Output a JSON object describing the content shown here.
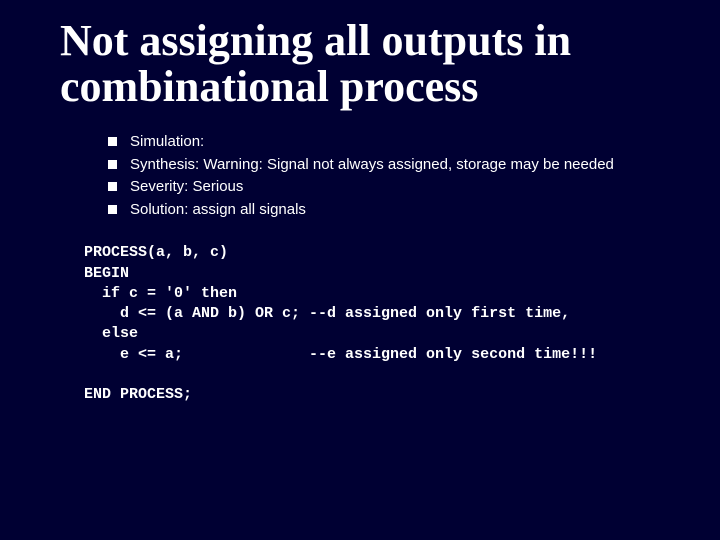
{
  "title": "Not assigning all outputs in combinational process",
  "bullets": [
    "Simulation:",
    "Synthesis: Warning: Signal not always assigned, storage may be needed",
    "Severity: Serious",
    "Solution: assign all signals"
  ],
  "code": "PROCESS(a, b, c)\nBEGIN\n  if c = '0' then\n    d <= (a AND b) OR c; --d assigned only first time,\n  else\n    e <= a;              --e assigned only second time!!!\n\nEND PROCESS;"
}
